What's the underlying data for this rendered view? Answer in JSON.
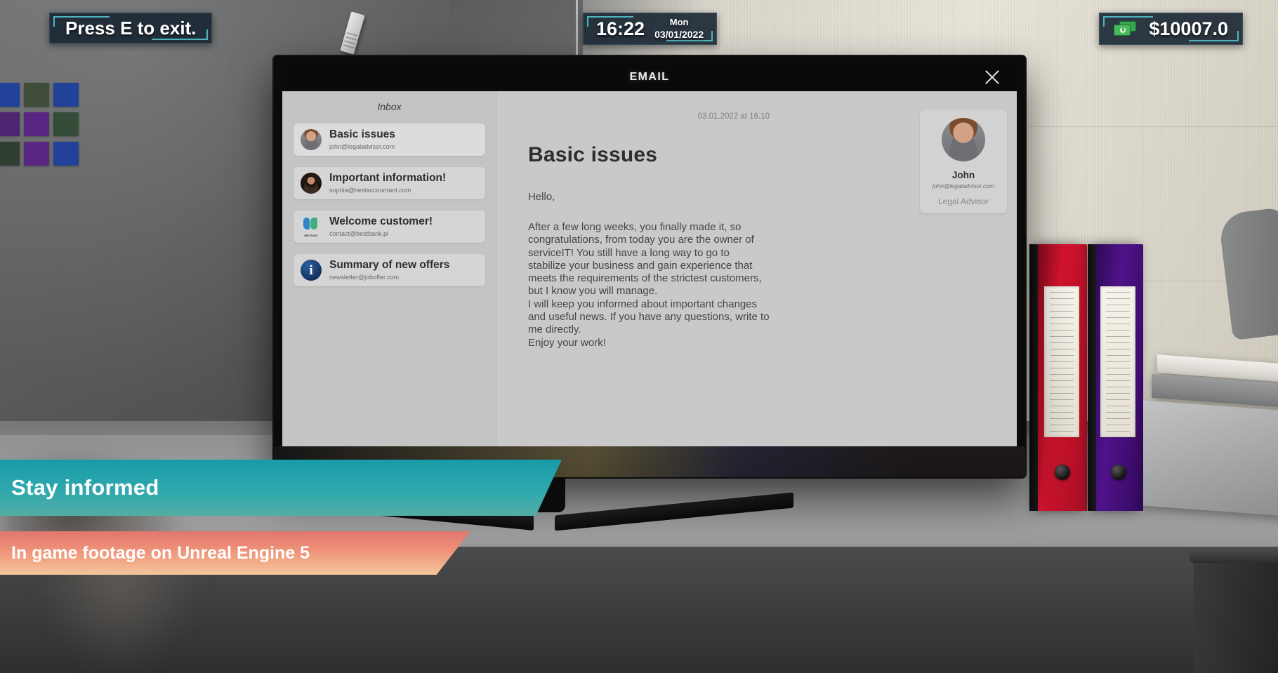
{
  "hud": {
    "hint": "Press E to exit.",
    "clock": {
      "time": "16:22",
      "day": "Mon",
      "date": "03/01/2022"
    },
    "money": {
      "amount": "$10007.0",
      "icon": "cash-icon",
      "symbol": "$"
    }
  },
  "window": {
    "title": "EMAIL",
    "close_icon": "close-icon"
  },
  "sidebar": {
    "title": "Inbox",
    "items": [
      {
        "subject": "Basic issues",
        "from": "john@legaladvisor.com",
        "icon": "avatar-john",
        "selected": true
      },
      {
        "subject": "Important information!",
        "from": "sophia@bestaccountant.com",
        "icon": "avatar-sophia",
        "selected": false
      },
      {
        "subject": "Welcome customer!",
        "from": "contact@bestbank.pl",
        "icon": "bestbank-logo-icon",
        "logo_text": "BESTBANK",
        "selected": false
      },
      {
        "subject": "Summary of new offers",
        "from": "newsletter@joboffer.com",
        "icon": "info-icon",
        "glyph": "i",
        "selected": false
      }
    ]
  },
  "reader": {
    "date": "03.01.2022 at 16.10",
    "subject": "Basic issues",
    "greeting": "Hello,",
    "paragraph_1": "After a few long weeks, you finally made it, so congratulations, from today you are the owner of serviceIT! You still have a long way to go to stabilize your business and gain experience that meets the requirements of the strictest customers, but I know you will manage.",
    "paragraph_2": "I will keep you informed about important changes and useful news. If you have any questions, write to me directly.\nEnjoy your work!",
    "sender": {
      "name": "John",
      "email": "john@legaladvisor.com",
      "role": "Legal Advisor",
      "avatar": "avatar-john"
    }
  },
  "promo": {
    "primary": "Stay informed",
    "secondary": "In game footage on Unreal Engine 5"
  },
  "colors": {
    "hud_bg": "#182632",
    "hud_accent": "#4fb3bf",
    "banner_primary": "#2fa8ae",
    "banner_secondary": "#ef9279",
    "money_green": "#46bb5e",
    "app_bg": "#c9c9c9"
  },
  "scene": {
    "sticky_notes": [
      "#1b3f9c",
      "#2f4a33",
      "#1b3f9c",
      "#4a2070",
      "#5a1f86",
      "#2f4a33",
      "#2a3b2c",
      "#5a1f86",
      "#1b3f9c"
    ],
    "binders": [
      {
        "name": "binder-red",
        "color": "#c8102e"
      },
      {
        "name": "binder-purple",
        "color": "#45117a"
      }
    ]
  }
}
